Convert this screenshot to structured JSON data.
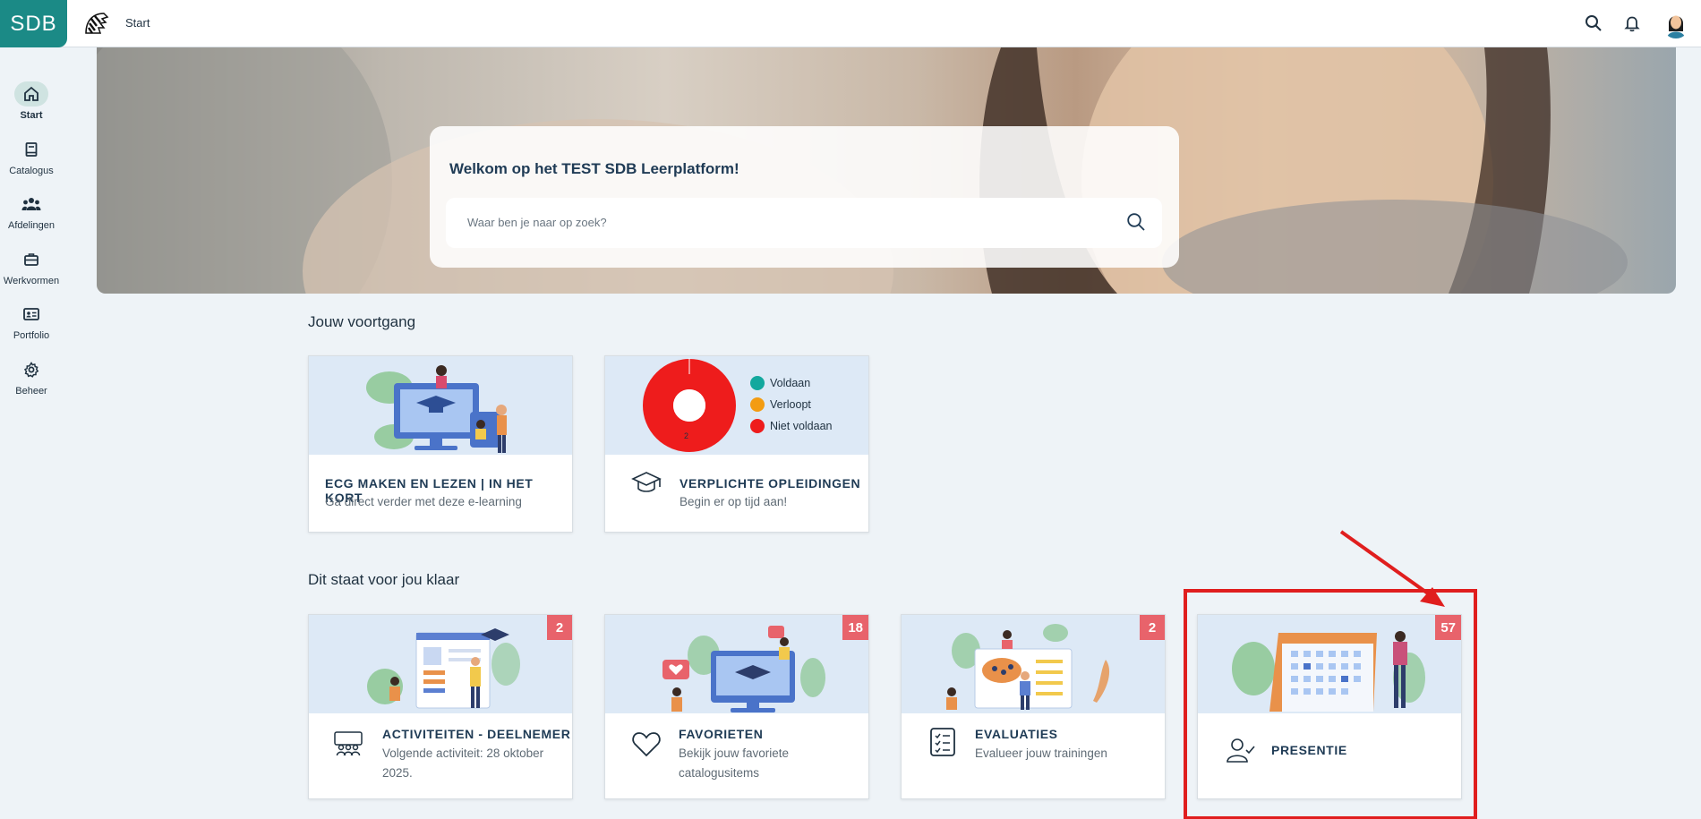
{
  "topbar": {
    "logo": "SDB",
    "breadcrumb": "Start",
    "icons": [
      "search-icon",
      "bell-icon",
      "user-avatar"
    ]
  },
  "nav": [
    {
      "label": "Start",
      "icon": "home-icon",
      "active": true
    },
    {
      "label": "Catalogus",
      "icon": "book-icon",
      "active": false
    },
    {
      "label": "Afdelingen",
      "icon": "people-icon",
      "active": false
    },
    {
      "label": "Werkvormen",
      "icon": "briefcase-icon",
      "active": false
    },
    {
      "label": "Portfolio",
      "icon": "id-card-icon",
      "active": false
    },
    {
      "label": "Beheer",
      "icon": "gear-icon",
      "active": false
    }
  ],
  "hero": {
    "title": "Welkom op het TEST SDB Leerplatform!",
    "search_placeholder": "Waar ben je naar op zoek?"
  },
  "progress": {
    "section_title": "Jouw voortgang",
    "cards": [
      {
        "title": "ECG MAKEN EN LEZEN | IN HET KORT",
        "subtitle": "Ga direct verder met deze e-learning"
      },
      {
        "title": "VERPLICHTE OPLEIDINGEN",
        "subtitle": "Begin er op tijd aan!",
        "icon": "graduation-cap-icon"
      }
    ],
    "donut": {
      "value_label": "2",
      "legend": [
        {
          "label": "Voldaan",
          "color": "#13a89e",
          "value": 0
        },
        {
          "label": "Verloopt",
          "color": "#f39c12",
          "value": 0
        },
        {
          "label": "Niet voldaan",
          "color": "#ee1c1c",
          "value": 2
        }
      ]
    }
  },
  "ready": {
    "section_title": "Dit staat voor jou klaar",
    "cards": [
      {
        "title": "ACTIVITEITEN - DEELNEMER",
        "subtitle_line1": "Volgende activiteit: 28 oktober",
        "subtitle_line2": "2025.",
        "badge": "2",
        "icon": "group-icon"
      },
      {
        "title": "FAVORIETEN",
        "subtitle_line1": "Bekijk jouw favoriete",
        "subtitle_line2": "catalogusitems",
        "badge": "18",
        "icon": "heart-icon"
      },
      {
        "title": "EVALUATIES",
        "subtitle_line1": "Evalueer jouw trainingen",
        "subtitle_line2": "",
        "badge": "2",
        "icon": "checklist-icon"
      },
      {
        "title": "PRESENTIE",
        "subtitle_line1": "",
        "subtitle_line2": "",
        "badge": "57",
        "icon": "user-check-icon"
      }
    ]
  },
  "colors": {
    "brand": "#1b8a86",
    "badge": "#e8636b",
    "annotation": "#e01e1e",
    "card_image_bg": "#dde9f6"
  }
}
